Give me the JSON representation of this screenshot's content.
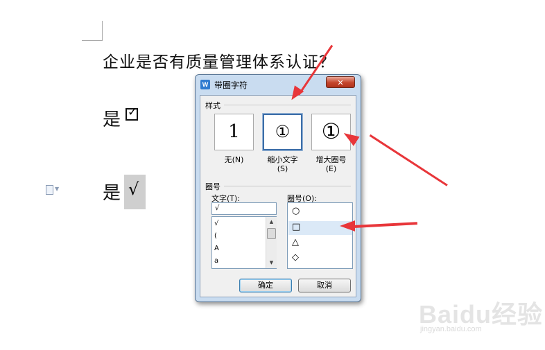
{
  "document": {
    "question": "企业是否有质量管理体系认证？",
    "answer1": "是",
    "answer1_mark": "☑",
    "answer2": "是",
    "answer2_mark": "√"
  },
  "dialog": {
    "title": "带圈字符",
    "close_label": "✕",
    "style_group": "样式",
    "styles": [
      {
        "label": "无(N)",
        "preview": "1"
      },
      {
        "label": "缩小文字",
        "hotkey": "(S)",
        "preview": "①"
      },
      {
        "label": "增大圈号",
        "hotkey": "(E)",
        "preview": "①"
      }
    ],
    "selected_style": 1,
    "circle_group": "圈号",
    "text_label": "文字(T):",
    "text_value": "√",
    "text_items": [
      "√",
      "(",
      "A",
      "a"
    ],
    "shape_label": "圈号(O):",
    "shape_items": [
      "○",
      "□",
      "△",
      "◇"
    ],
    "selected_shape": 1,
    "ok_label": "确定",
    "cancel_label": "取消"
  },
  "watermark": {
    "brand": "Baidu经验",
    "url": "jingyan.baidu.com"
  },
  "colors": {
    "arrow": "#e8363a",
    "dialog_frame": "#c9dcf0",
    "selection": "#dbe9f7"
  }
}
